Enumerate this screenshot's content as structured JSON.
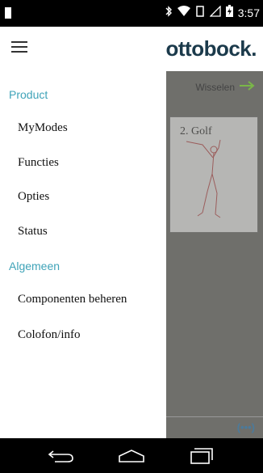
{
  "status_bar": {
    "time": "3:57",
    "icons": [
      "bluetooth-icon",
      "wifi-icon",
      "vibrate-icon",
      "signal-icon",
      "battery-icon"
    ]
  },
  "app_bar": {
    "logo_text": "ottobock."
  },
  "background": {
    "switch_label": "Wisselen",
    "card_label": "2. Golf"
  },
  "drawer": {
    "sections": [
      {
        "heading": "Product",
        "items": [
          "MyModes",
          "Functies",
          "Opties",
          "Status"
        ]
      },
      {
        "heading": "Algemeen",
        "items": [
          "Componenten beheren",
          "Colofon/info"
        ]
      }
    ]
  },
  "colors": {
    "accent": "#3fa3b8",
    "overlay": "#6f6f6b",
    "arrow": "#7ab648",
    "radio": "#3c7fb0"
  }
}
